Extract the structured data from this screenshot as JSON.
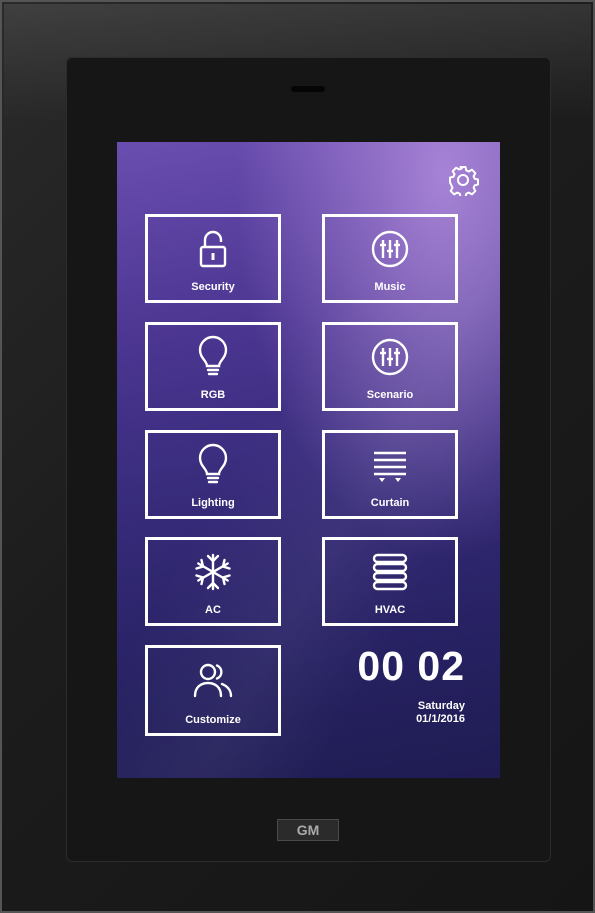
{
  "tiles": {
    "security": "Security",
    "music": "Music",
    "rgb": "RGB",
    "scenario": "Scenario",
    "lighting": "Lighting",
    "curtain": "Curtain",
    "ac": "AC",
    "hvac": "HVAC",
    "customize": "Customize"
  },
  "clock": {
    "time": "00 02",
    "day": "Saturday",
    "date": "01/1/2016"
  },
  "brand": "GM",
  "icons": [
    "gear-icon",
    "lock-icon",
    "equalizer-icon",
    "bulb-icon",
    "curtain-icon",
    "snowflake-icon",
    "hvac-icon",
    "users-icon"
  ]
}
